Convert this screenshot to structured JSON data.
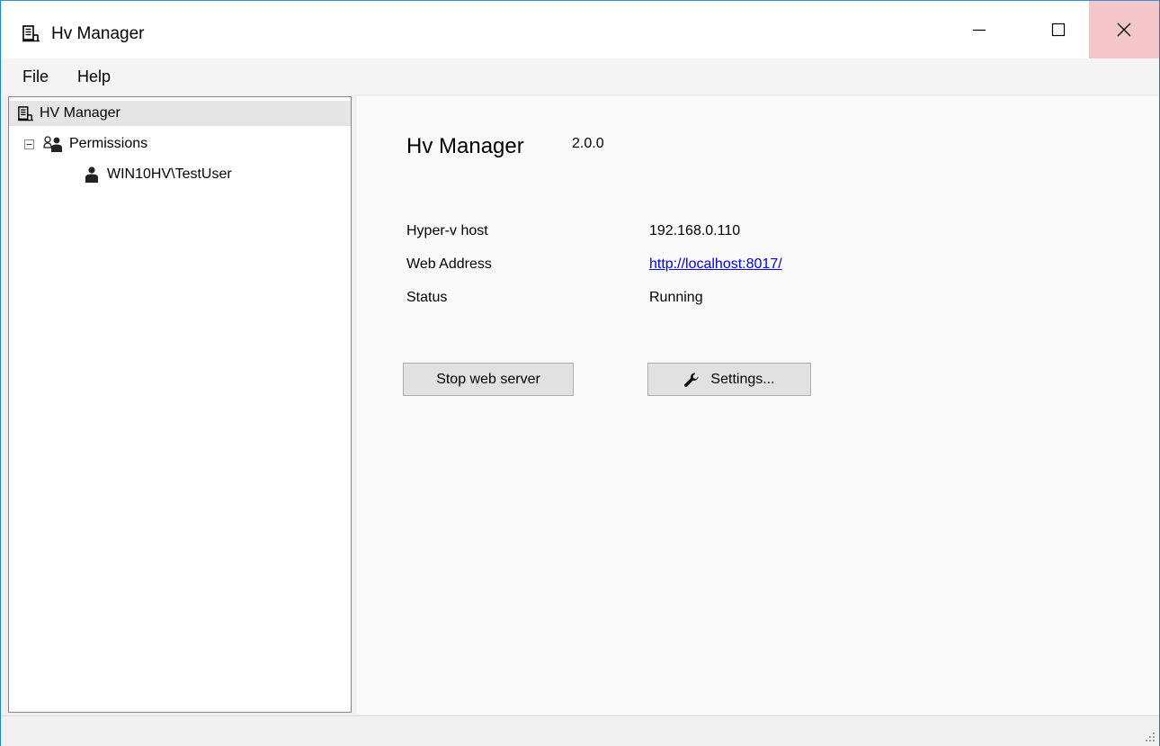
{
  "window": {
    "title": "Hv Manager",
    "icons": {
      "app": "server-icon",
      "minimize": "minimize-icon",
      "maximize": "maximize-icon",
      "close": "close-icon"
    },
    "close_hover_color": "#f4c7cb"
  },
  "menu": {
    "items": [
      {
        "label": "File"
      },
      {
        "label": "Help"
      }
    ]
  },
  "tree": {
    "root": {
      "label": "HV Manager",
      "icon": "server-icon",
      "selected": true
    },
    "permissions": {
      "label": "Permissions",
      "icon": "users-icon",
      "expander": "⊟",
      "expanded": true
    },
    "user": {
      "label": "WIN10HV\\TestUser",
      "icon": "user-icon"
    }
  },
  "main": {
    "app_name": "Hv Manager",
    "version": "2.0.0",
    "info": [
      {
        "label": "Hyper-v host",
        "value": "192.168.0.110"
      },
      {
        "label": "Web Address",
        "value": "http://localhost:8017/"
      },
      {
        "label": "Status",
        "value": "Running"
      }
    ],
    "buttons": {
      "stop": "Stop web server",
      "settings": "Settings...",
      "settings_icon": "wrench-icon"
    }
  },
  "colors": {
    "link": "#0000ee",
    "selection": "#e5e5e5",
    "window_border": "#1883d7"
  }
}
